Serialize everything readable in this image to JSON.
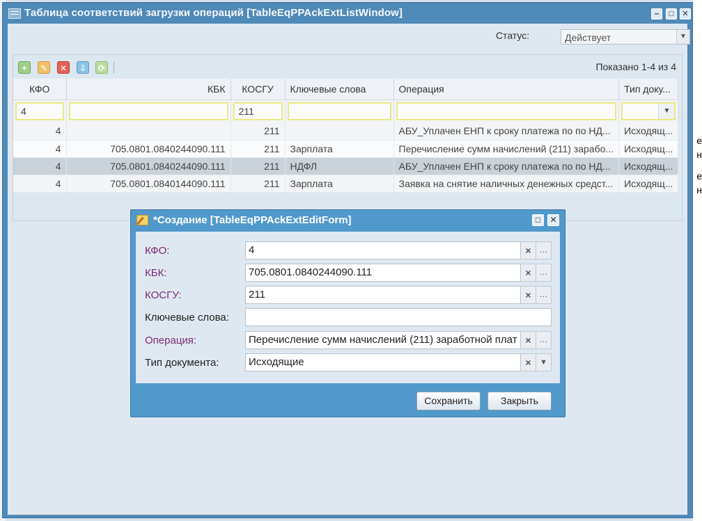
{
  "window": {
    "title": "Таблица соответствий загрузки операций [TableEqPPAckExtListWindow]"
  },
  "status": {
    "label": "Статус:",
    "value": "Действует"
  },
  "grid": {
    "shown": "Показано 1-4 из 4",
    "columns": [
      "КФО",
      "КБК",
      "КОСГУ",
      "Ключевые слова",
      "Операция",
      "Тип доку..."
    ],
    "filters": {
      "kfo": "4",
      "kbk": "",
      "kosgu": "211",
      "keywords": "",
      "operation": "",
      "doc_type": ""
    },
    "rows": [
      {
        "kfo": "4",
        "kbk": "",
        "kosgu": "211",
        "keywords": "",
        "operation": "АБУ_Уплачен ЕНП к сроку платежа по по НД...",
        "doc_type": "Исходящ..."
      },
      {
        "kfo": "4",
        "kbk": "705.0801.0840244090.111",
        "kosgu": "211",
        "keywords": "Зарплата",
        "operation": "Перечисление сумм начислений (211) зарабо...",
        "doc_type": "Исходящ..."
      },
      {
        "kfo": "4",
        "kbk": "705.0801.0840244090.111",
        "kosgu": "211",
        "keywords": "НДФЛ",
        "operation": "АБУ_Уплачен ЕНП к сроку платежа по по НД...",
        "doc_type": "Исходящ..."
      },
      {
        "kfo": "4",
        "kbk": "705.0801.0840144090.111",
        "kosgu": "211",
        "keywords": "Зарплата",
        "operation": "Заявка на снятие наличных денежных средст...",
        "doc_type": "Исходящ..."
      }
    ]
  },
  "dialog": {
    "title": "*Создание [TableEqPPAckExtEditForm]",
    "fields": {
      "kfo": {
        "label": "КФО:",
        "value": "4"
      },
      "kbk": {
        "label": "КБК:",
        "value": "705.0801.0840244090.111"
      },
      "kosgu": {
        "label": "КОСГУ:",
        "value": "211"
      },
      "keywords": {
        "label": "Ключевые слова:",
        "value": ""
      },
      "operation": {
        "label": "Операция:",
        "value": "Перечисление сумм начислений (211) заработной плат"
      },
      "doc_type": {
        "label": "Тип документа:",
        "value": "Исходящие"
      }
    },
    "save_label": "Сохранить",
    "close_label": "Закрыть"
  },
  "background": {
    "fragments": [
      "е",
      "н",
      "е",
      "н"
    ]
  },
  "colors": {
    "window_frame": "#4f8ab8",
    "dialog_frame": "#5199cb",
    "required_label": "#7a2a7a",
    "filter_highlight": "#e8ea85"
  }
}
